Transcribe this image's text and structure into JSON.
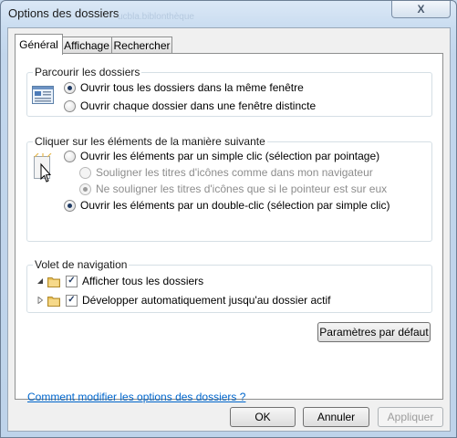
{
  "window": {
    "title": "Options des dossiers",
    "close_symbol": "X",
    "background_ghost_text": "ucbla.biblonthèque"
  },
  "tabs": [
    {
      "label": "Général",
      "active": true
    },
    {
      "label": "Affichage",
      "active": false
    },
    {
      "label": "Rechercher",
      "active": false
    }
  ],
  "browse": {
    "legend": "Parcourir les dossiers",
    "icon": "same-window-icon",
    "options": [
      {
        "label": "Ouvrir tous les dossiers dans la même fenêtre",
        "selected": true
      },
      {
        "label": "Ouvrir chaque dossier dans une fenêtre distincte",
        "selected": false
      }
    ]
  },
  "click": {
    "legend": "Cliquer sur les éléments de la manière suivante",
    "icon": "pointer-click-icon",
    "single_click": {
      "label": "Ouvrir les éléments par un simple clic (sélection par pointage)",
      "selected": false
    },
    "sub_options": [
      {
        "label": "Souligner les titres d'icônes comme dans mon navigateur",
        "selected": false
      },
      {
        "label": "Ne souligner les titres d'icônes que si le pointeur est sur eux",
        "selected": true
      }
    ],
    "double_click": {
      "label": "Ouvrir les éléments par un double-clic (sélection par simple clic)",
      "selected": true
    }
  },
  "nav_pane": {
    "legend": "Volet de navigation",
    "options": [
      {
        "label": "Afficher tous les dossiers",
        "checked": true
      },
      {
        "label": "Développer automatiquement jusqu'au dossier actif",
        "checked": true
      }
    ]
  },
  "defaults_button": "Paramètres par défaut",
  "help_link": "Comment modifier les options des dossiers ?",
  "footer": {
    "ok": "OK",
    "cancel": "Annuler",
    "apply": "Appliquer"
  }
}
